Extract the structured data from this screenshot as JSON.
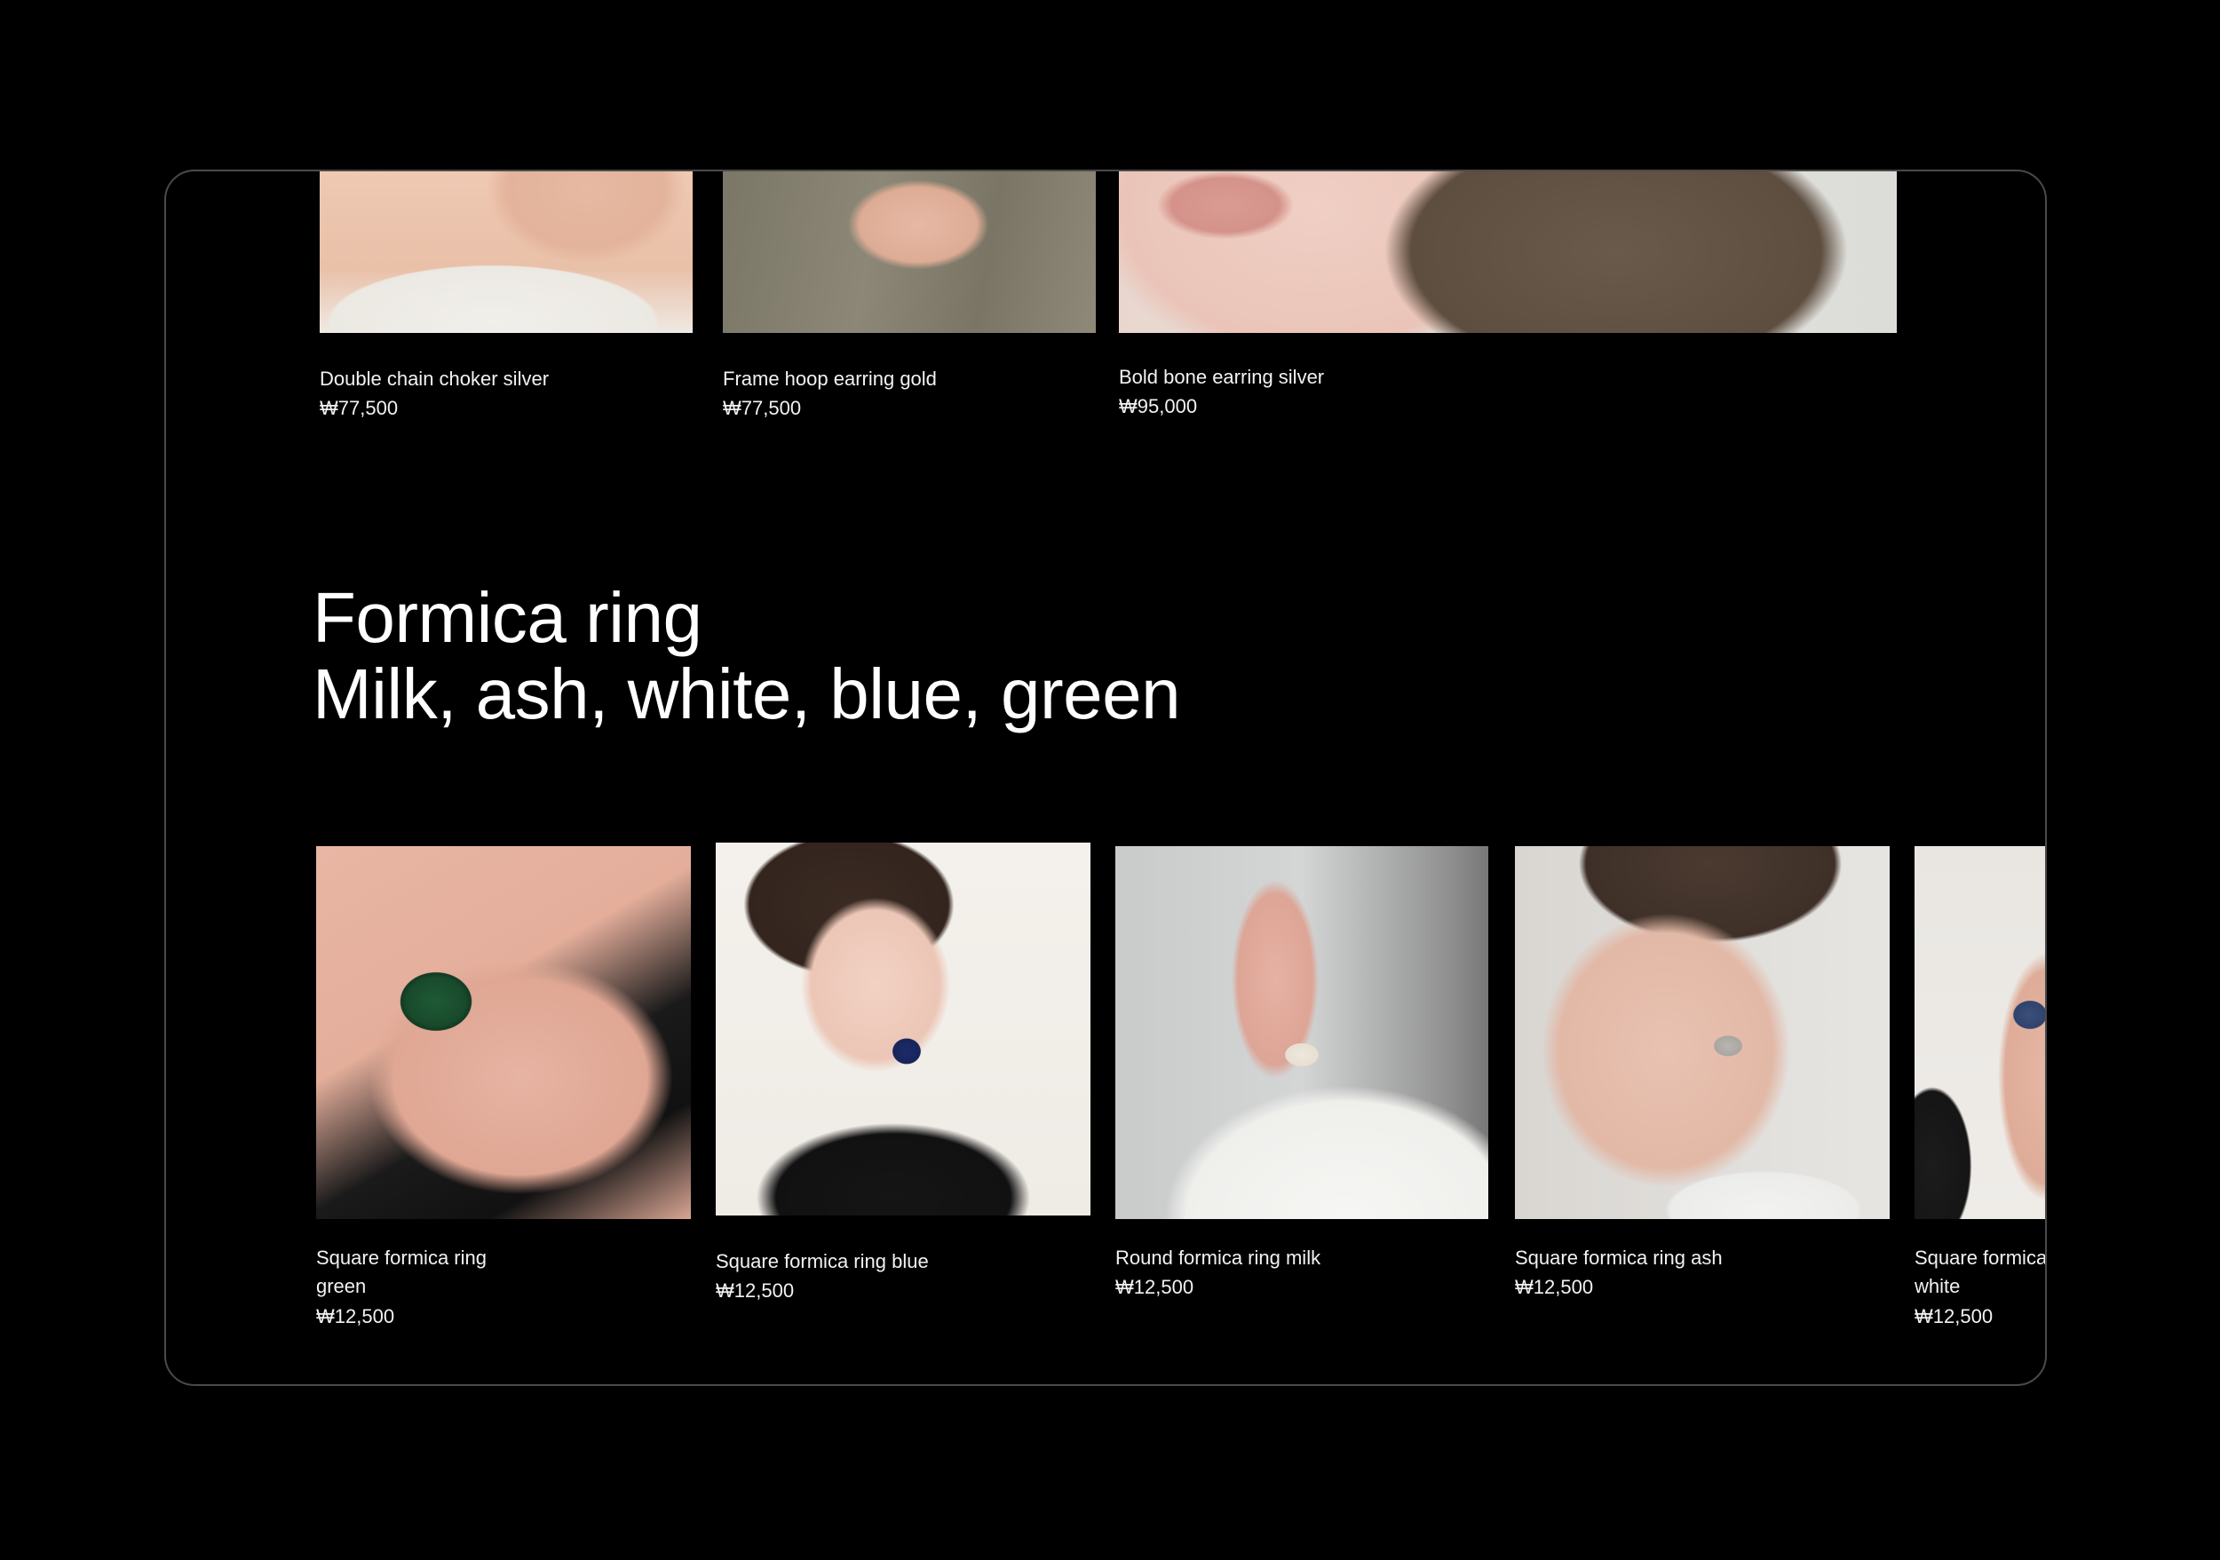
{
  "top_products": [
    {
      "name": "Double chain choker silver",
      "price": "₩77,500",
      "photo": "model-wearing-white-top-and-choker"
    },
    {
      "name": "Frame hoop earring gold",
      "price": "₩77,500",
      "photo": "model-in-olive-jacket"
    },
    {
      "name": "Bold bone earring silver",
      "price": "₩95,000",
      "photo": "model-lips-and-short-hair"
    }
  ],
  "section": {
    "title_line1": "Formica ring",
    "title_line2": "Milk, ash, white, blue, green"
  },
  "ring_products": [
    {
      "name": "Square formica ring green",
      "price": "₩12,500",
      "photo": "hand-with-green-ring"
    },
    {
      "name": "Square formica ring blue",
      "price": "₩12,500",
      "photo": "woman-with-blue-ring"
    },
    {
      "name": "Round formica ring milk",
      "price": "₩12,500",
      "photo": "hand-with-milk-ring"
    },
    {
      "name": "Square formica ring ash",
      "price": "₩12,500",
      "photo": "woman-with-ash-ring"
    },
    {
      "name": "Square formica ring white",
      "price": "₩12,500",
      "photo": "woman-with-white-ring"
    }
  ],
  "colors": {
    "background": "#000000",
    "frame_border": "#4a4a4a",
    "text": "#f2f2f2"
  }
}
